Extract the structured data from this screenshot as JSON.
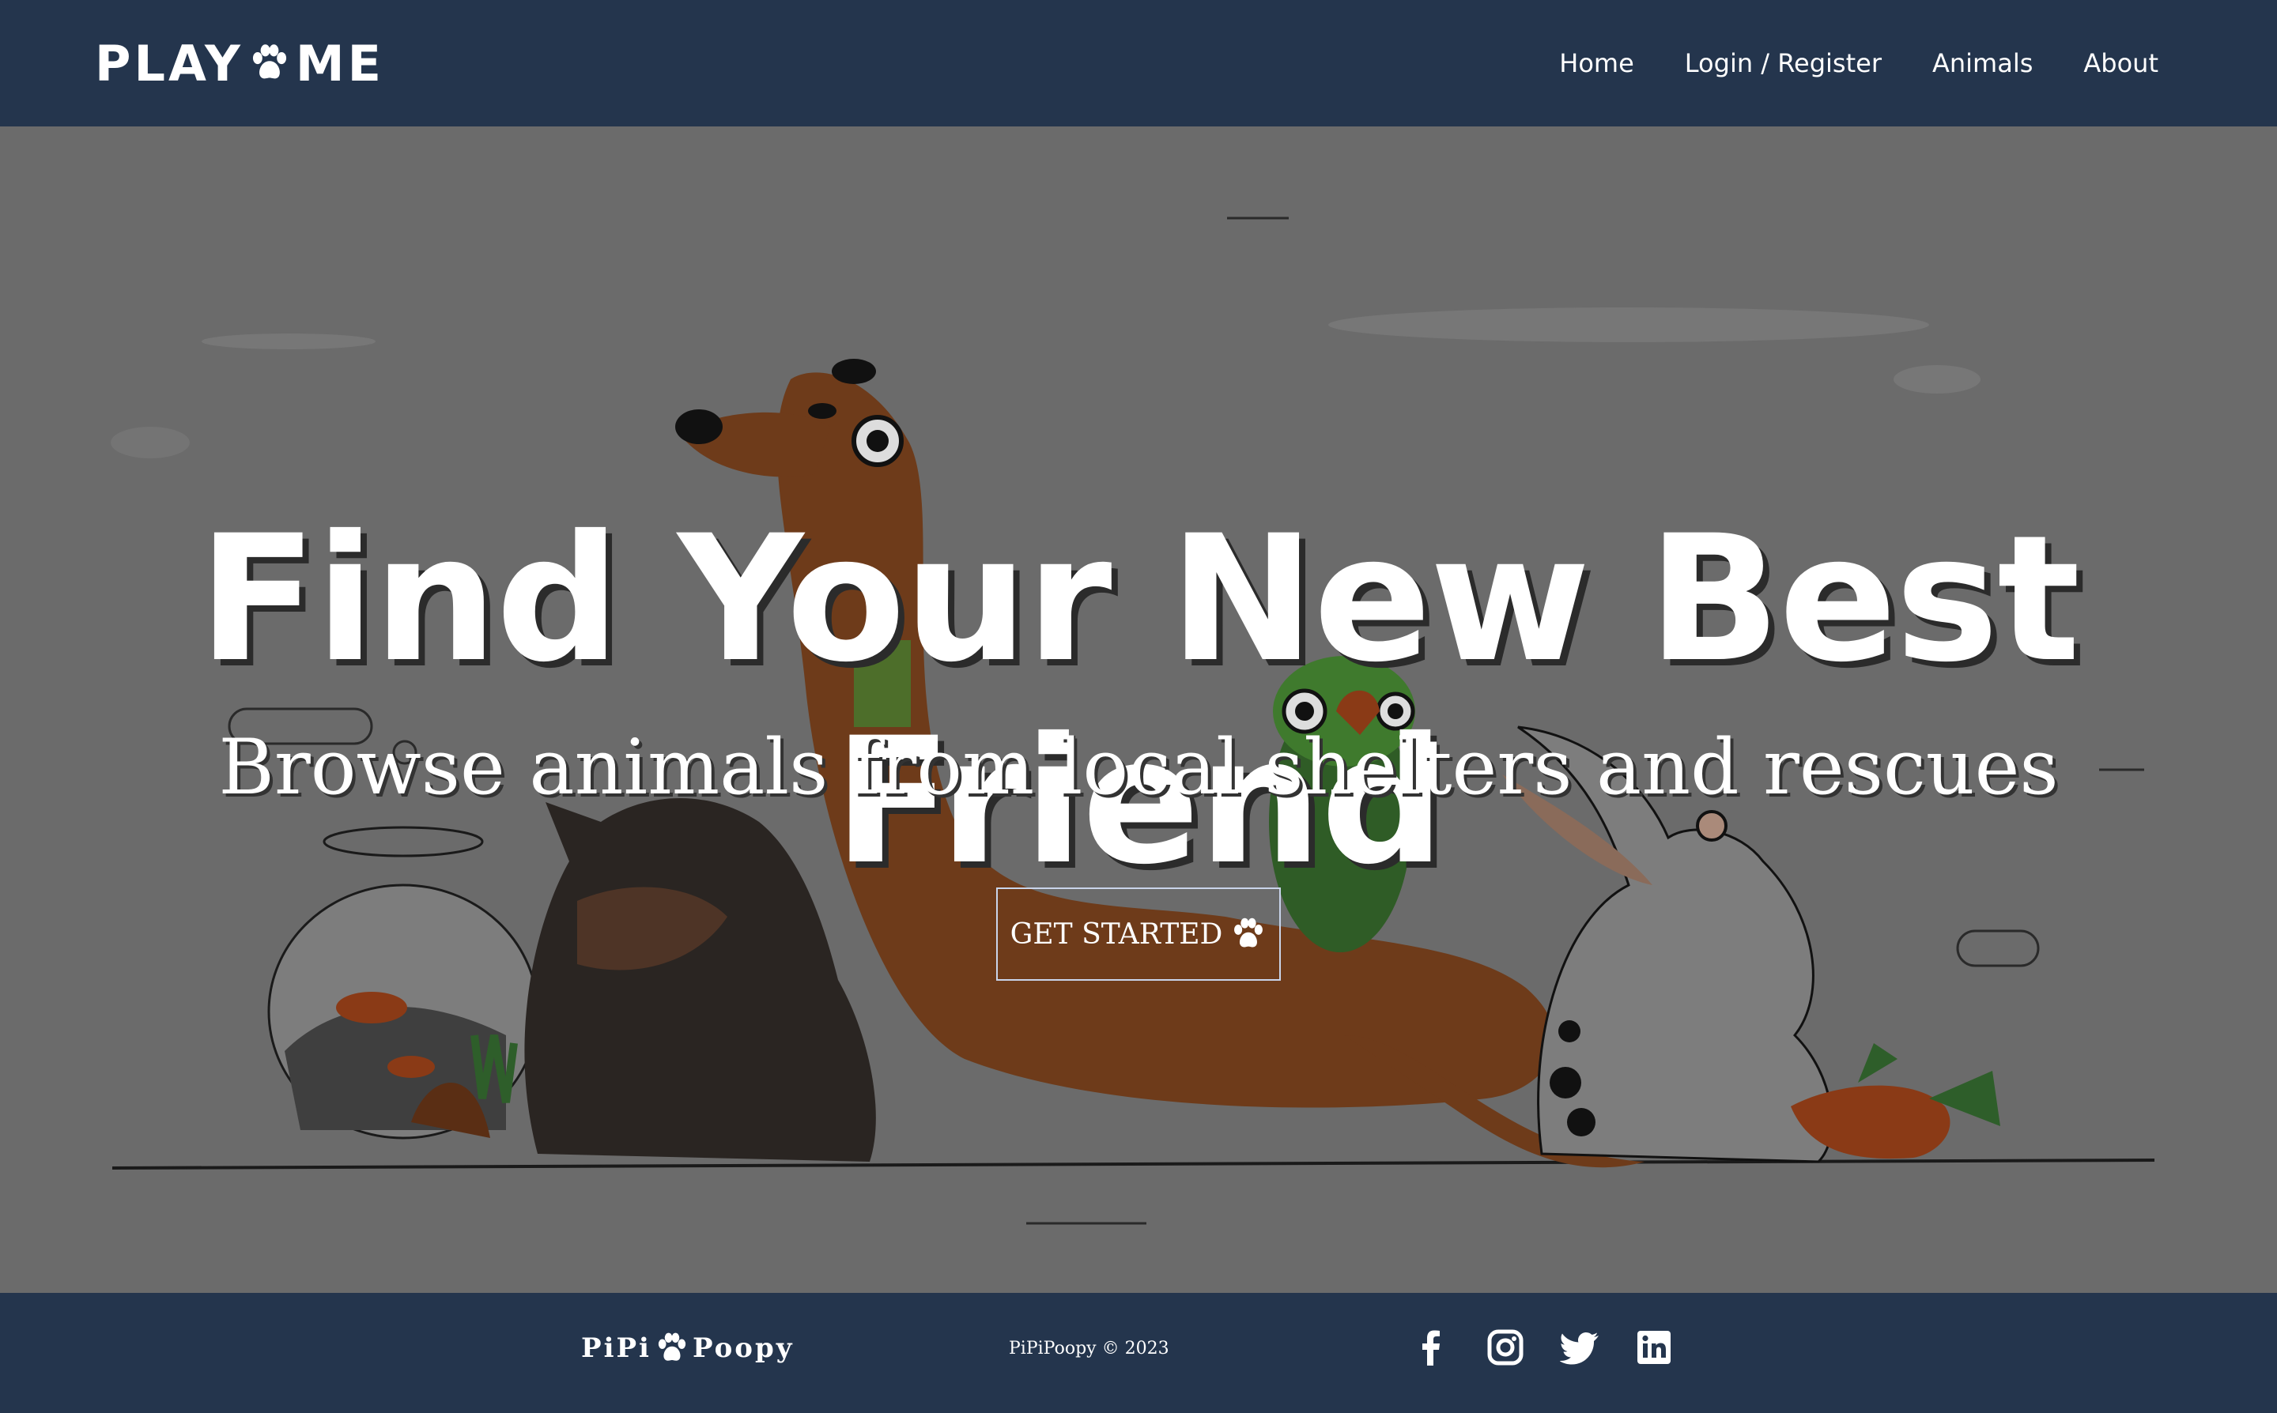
{
  "header": {
    "brand_left": "PLAY",
    "brand_right": "ME",
    "nav": [
      "Home",
      "Login / Register",
      "Animals",
      "About"
    ]
  },
  "hero": {
    "title": "Find Your New Best Friend",
    "subtitle": "Browse animals from local shelters and rescues",
    "cta_label": "GET STARTED"
  },
  "footer": {
    "brand_left": "PiPi",
    "brand_right": "Poopy",
    "copyright": "PiPiPoopy © 2023",
    "social": [
      "facebook-icon",
      "instagram-icon",
      "twitter-icon",
      "linkedin-icon"
    ]
  },
  "colors": {
    "header_bg": "#24354d",
    "hero_overlay": "#6b6b6b",
    "text": "#ffffff"
  }
}
